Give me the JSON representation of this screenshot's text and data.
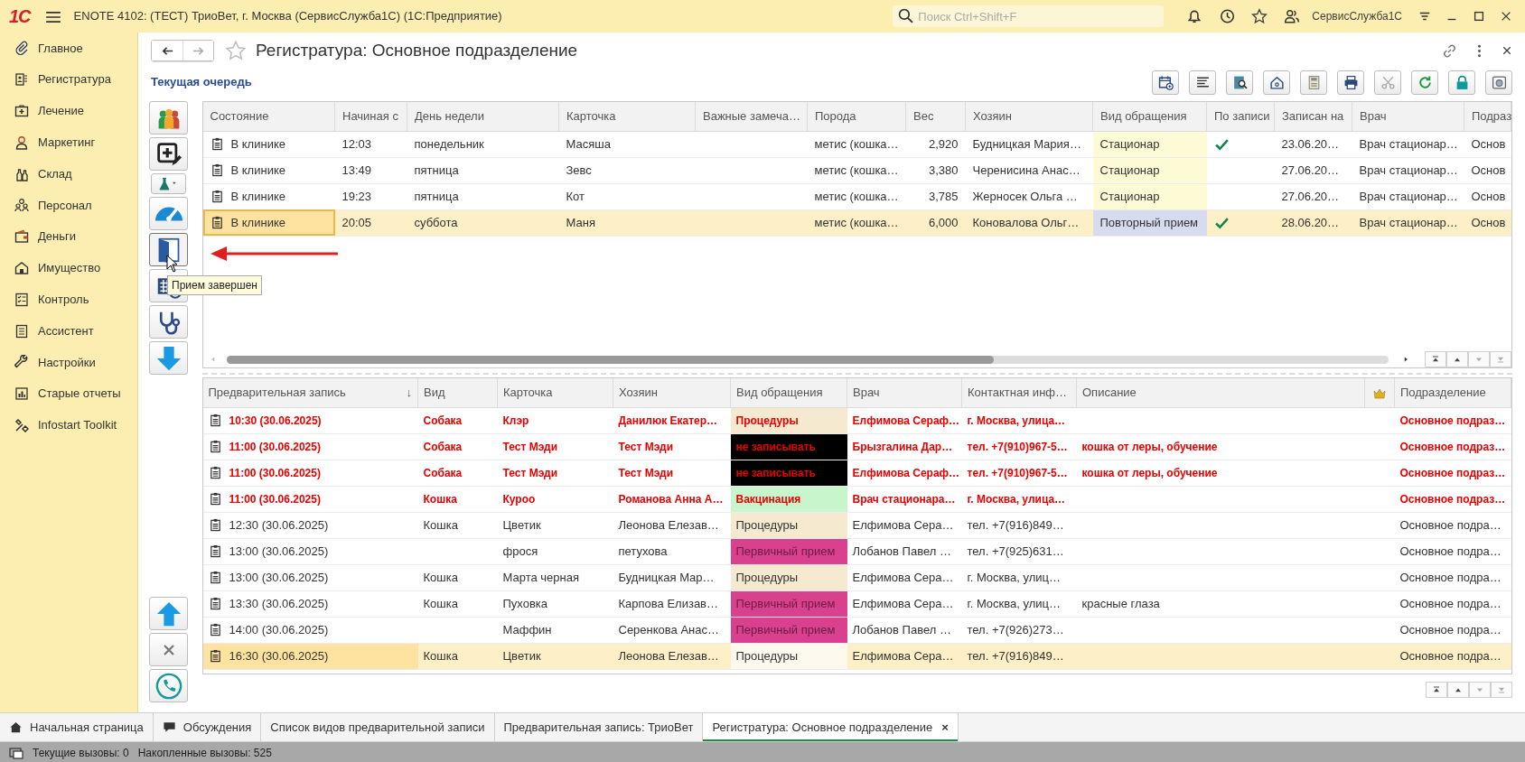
{
  "app_bar": {
    "logo": "1С",
    "title": "ENOTE 4102: (ТЕСТ) ТриоВет, г. Москва (СервисСлужба1С)  (1С:Предприятие)",
    "search": {
      "placeholder": "Поиск Ctrl+Shift+F"
    },
    "user": "СервисСлужба1С"
  },
  "sidebar": {
    "items": [
      {
        "label": "Главное"
      },
      {
        "label": "Регистратура"
      },
      {
        "label": "Лечение"
      },
      {
        "label": "Маркетинг"
      },
      {
        "label": "Склад"
      },
      {
        "label": "Персонал"
      },
      {
        "label": "Деньги"
      },
      {
        "label": "Имущество"
      },
      {
        "label": "Контроль"
      },
      {
        "label": "Ассистент"
      },
      {
        "label": "Настройки"
      },
      {
        "label": "Старые отчеты"
      },
      {
        "label": "Infostart Toolkit"
      }
    ]
  },
  "form": {
    "title": "Регистратура: Основное подразделение",
    "section_title": "Текущая очередь",
    "tooltip": "Прием завершен"
  },
  "queue": {
    "columns": [
      "Состояние",
      "Начиная с",
      "День недели",
      "Карточка",
      "Важные замеча…",
      "Порода",
      "Вес",
      "Хозяин",
      "Вид обращения",
      "По записи",
      "Записан на",
      "Врач",
      "Подраз"
    ],
    "rows": [
      {
        "state": "В клинике",
        "start": "12:03",
        "weekday": "понедельник",
        "card": "Масяша",
        "breed": "метис (кошка…",
        "weight": "2,920",
        "owner": "Будницкая Мария…",
        "visit": "Стационар",
        "color": "#fdfad6",
        "booked": true,
        "booked_on": "23.06.20…",
        "doctor": "Врач стационар…",
        "division": "Основ",
        "selected": false
      },
      {
        "state": "В клинике",
        "start": "13:49",
        "weekday": "пятница",
        "card": "Зевс",
        "breed": "метис (кошка…",
        "weight": "3,380",
        "owner": "Черенисина Анас…",
        "visit": "Стационар",
        "color": "#fdfad6",
        "booked": false,
        "booked_on": "27.06.20…",
        "doctor": "Врач стационар…",
        "division": "Основ",
        "selected": false
      },
      {
        "state": "В клинике",
        "start": "19:23",
        "weekday": "пятница",
        "card": "Кот",
        "breed": "метис (кошка…",
        "weight": "3,785",
        "owner": "Жерносек Ольга …",
        "visit": "Стационар",
        "color": "#fdfad6",
        "booked": false,
        "booked_on": "27.06.20…",
        "doctor": "Врач стационар…",
        "division": "Основ",
        "selected": false
      },
      {
        "state": "В клинике",
        "start": "20:05",
        "weekday": "суббота",
        "card": "Маня",
        "breed": "метис (кошка…",
        "weight": "6,000",
        "owner": "Коновалова Ольг…",
        "visit": "Повторный прием",
        "color": "#d6dbf0",
        "booked": true,
        "booked_on": "28.06.20…",
        "doctor": "Врач стационар…",
        "division": "Основ",
        "selected": true
      }
    ]
  },
  "appointments": {
    "columns": [
      {
        "kind": "text",
        "label": "Предварительная запись",
        "sort_mark": "↓"
      },
      {
        "kind": "text",
        "label": "Вид"
      },
      {
        "kind": "text",
        "label": "Карточка"
      },
      {
        "kind": "text",
        "label": "Хозяин"
      },
      {
        "kind": "text",
        "label": "Вид обращения"
      },
      {
        "kind": "text",
        "label": "Врач"
      },
      {
        "kind": "text",
        "label": "Контактная инф…"
      },
      {
        "kind": "text",
        "label": "Описание"
      },
      {
        "kind": "crown"
      },
      {
        "kind": "text",
        "label": "Подразделение"
      }
    ],
    "rows": [
      {
        "time": "10:30 (30.06.2025)",
        "species": "Собака",
        "card": "Клэр",
        "owner": "Данилюк Екатер…",
        "visit": "Процедуры",
        "color": "#f5ead0",
        "doctor": "Елфимова Сераф…",
        "contact": "г. Москва, улица…",
        "division": "Основное подраз…",
        "urgent": true,
        "selected": false
      },
      {
        "time": "11:00 (30.06.2025)",
        "species": "Собака",
        "card": "Тест Мэди",
        "owner": "Тест Мэди",
        "visit": "не записывать",
        "color": "#000000",
        "doctor": "Брызгалина Дар…",
        "contact": "тел. +7(910)967-5…",
        "description": "кошка от леры, обучение",
        "division": "Основное подраз…",
        "urgent": true,
        "selected": false
      },
      {
        "time": "11:00 (30.06.2025)",
        "species": "Собака",
        "card": "Тест Мэди",
        "owner": "Тест Мэди",
        "visit": "не записывать",
        "color": "#000000",
        "doctor": "Елфимова Сераф…",
        "contact": "тел. +7(910)967-5…",
        "description": "кошка от леры, обучение",
        "division": "Основное подраз…",
        "urgent": true,
        "selected": false
      },
      {
        "time": "11:00 (30.06.2025)",
        "species": "Кошка",
        "card": "Куроо",
        "owner": "Романова Анна А…",
        "visit": "Вакцинация",
        "color": "#c9f5cc",
        "doctor": "Врач стационара…",
        "contact": "г. Москва, улица…",
        "division": "Основное подраз…",
        "urgent": true,
        "selected": false
      },
      {
        "time": "12:30 (30.06.2025)",
        "species": "Кошка",
        "card": "Цветик",
        "owner": "Леонова Елезав…",
        "visit": "Процедуры",
        "color": "#f5ead0",
        "doctor": "Елфимова Сера…",
        "contact": "тел. +7(916)849…",
        "division": "Основное подра…",
        "urgent": false,
        "selected": false
      },
      {
        "time": "13:00 (30.06.2025)",
        "card": "фрося",
        "owner": "петухова",
        "visit": "Первичный прием",
        "color": "#d9418f",
        "doctor": "Лобанов Павел …",
        "contact": "тел. +7(925)631…",
        "division": "Основное подра…",
        "urgent": false,
        "selected": false
      },
      {
        "time": "13:00 (30.06.2025)",
        "species": "Кошка",
        "card": "Марта черная",
        "owner": "Будницкая Мар…",
        "visit": "Процедуры",
        "color": "#f5ead0",
        "doctor": "Елфимова Сера…",
        "contact": "г. Москва, улиц…",
        "division": "Основное подра…",
        "urgent": false,
        "selected": false
      },
      {
        "time": "13:30 (30.06.2025)",
        "species": "Кошка",
        "card": "Пуховка",
        "owner": "Карпова Елизав…",
        "visit": "Первичный прием",
        "color": "#d9418f",
        "doctor": "Елфимова Сера…",
        "contact": "г. Москва, улиц…",
        "description": "красные глаза",
        "division": "Основное подра…",
        "urgent": false,
        "selected": false
      },
      {
        "time": "14:00 (30.06.2025)",
        "card": "Маффин",
        "owner": "Серенкова Анас…",
        "visit": "Первичный прием",
        "color": "#d9418f",
        "doctor": "Лобанов Павел …",
        "contact": "тел. +7(926)273…",
        "division": "Основное подра…",
        "urgent": false,
        "selected": false
      },
      {
        "time": "16:30 (30.06.2025)",
        "species": "Кошка",
        "card": "Цветик",
        "owner": "Леонова Елезав…",
        "visit": "Процедуры",
        "color": "#fdf9ef",
        "doctor": "Елфимова Сера…",
        "contact": "тел. +7(916)849…",
        "division": "Основное подра…",
        "urgent": false,
        "selected": true
      }
    ]
  },
  "tabs": [
    {
      "label": "Начальная страница",
      "selected": false
    },
    {
      "label": "Обсуждения",
      "selected": false
    },
    {
      "label": "Список видов предварительной записи",
      "selected": false
    },
    {
      "label": "Предварительная запись: ТриоВет",
      "selected": false
    },
    {
      "label": "Регистратура: Основное подразделение",
      "selected": true,
      "close": "×"
    }
  ],
  "status_bar": {
    "current_calls": "Текущие вызовы: 0",
    "accumulated_calls": "Накопленные вызовы: 525"
  }
}
